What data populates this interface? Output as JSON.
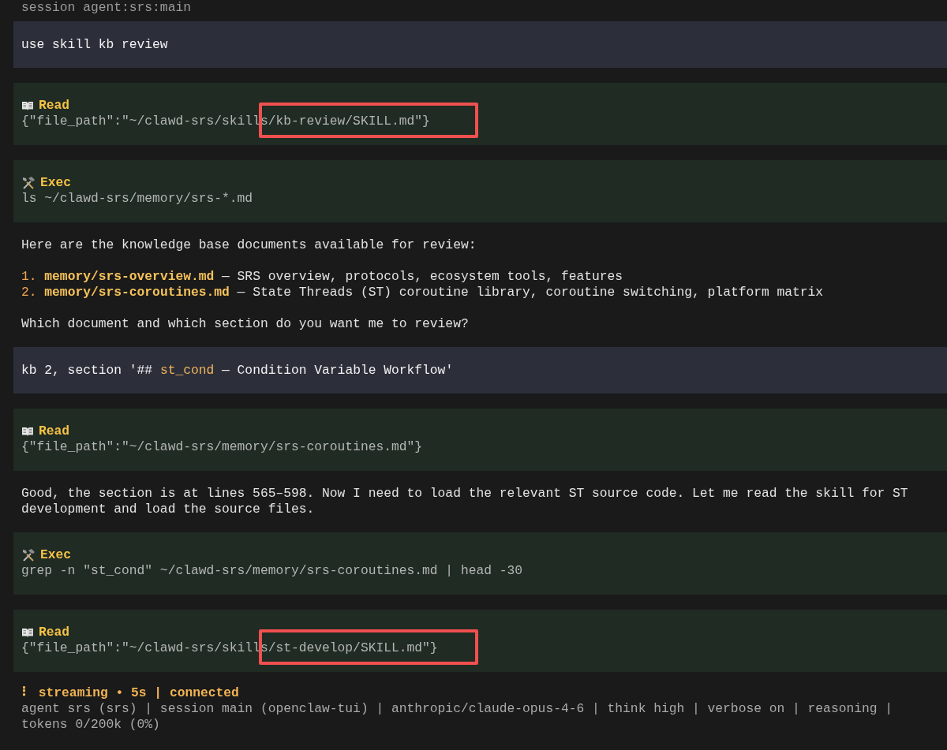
{
  "session_line": "session agent:srs:main",
  "messages": [
    {
      "kind": "user",
      "parts": [
        {
          "text": "use skill kb review"
        }
      ]
    },
    {
      "kind": "read_tool",
      "label": "Read",
      "args": "{\"file_path\":\"~/clawd-srs/skills/kb-review/SKILL.md\"}",
      "annotated": true
    },
    {
      "kind": "exec_tool",
      "label": "Exec",
      "args": "ls ~/clawd-srs/memory/srs-*.md",
      "annotated": false
    },
    {
      "kind": "assistant",
      "paragraphs": [
        {
          "kind": "text",
          "text": "Here are the knowledge base documents available for review:"
        },
        {
          "kind": "list",
          "items": [
            {
              "number": "1.",
              "file": "memory/srs-overview.md",
              "rest": " — SRS overview, protocols, ecosystem tools, features"
            },
            {
              "number": "2.",
              "file": "memory/srs-coroutines.md",
              "rest": " — State Threads (ST) coroutine library, coroutine switching, platform matrix"
            }
          ]
        },
        {
          "kind": "text",
          "text": "Which document and which section do you want me to review?"
        }
      ]
    },
    {
      "kind": "user",
      "parts": [
        {
          "text": "kb 2, section '## "
        },
        {
          "text": "st_cond",
          "code": true
        },
        {
          "text": " — Condition Variable Workflow'"
        }
      ]
    },
    {
      "kind": "read_tool",
      "label": "Read",
      "args": "{\"file_path\":\"~/clawd-srs/memory/srs-coroutines.md\"}",
      "annotated": false
    },
    {
      "kind": "assistant",
      "paragraphs": [
        {
          "kind": "text",
          "text": "Good, the section is at lines 565–598. Now I need to load the relevant ST source code. Let me read the skill for ST development and load the source files."
        }
      ]
    },
    {
      "kind": "exec_tool",
      "label": "Exec",
      "args": "grep -n \"st_cond\" ~/clawd-srs/memory/srs-coroutines.md | head -30",
      "annotated": false
    },
    {
      "kind": "read_tool",
      "label": "Read",
      "args": "{\"file_path\":\"~/clawd-srs/skills/st-develop/SKILL.md\"}",
      "annotated": true
    }
  ],
  "status": {
    "spinner": "⠇",
    "state": "streaming • 5s | connected",
    "info": "agent srs (srs) | session main (openclaw-tui) | anthropic/claude-opus-4-6 | think high | verbose on | reasoning | tokens 0/200k (0%)"
  }
}
